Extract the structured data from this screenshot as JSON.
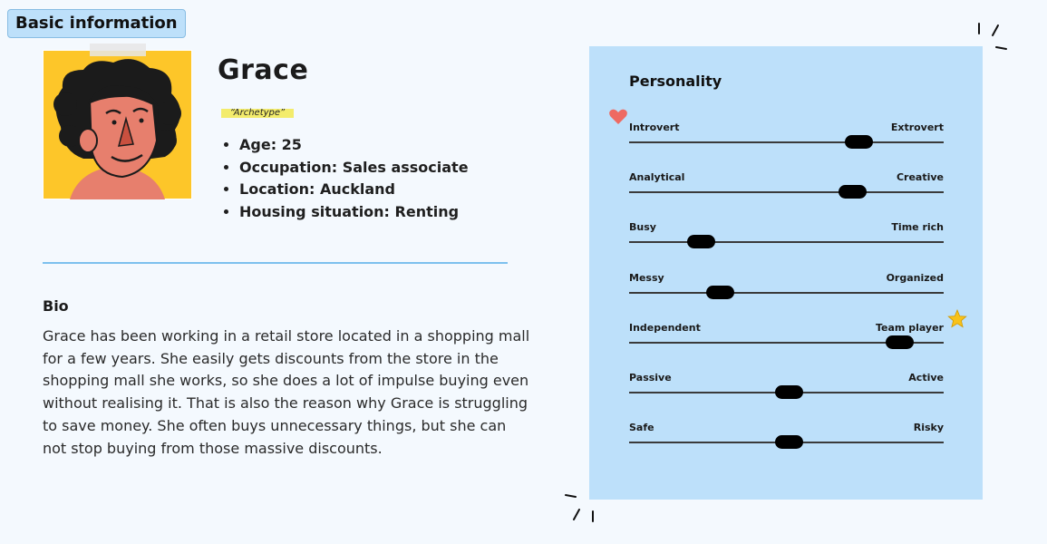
{
  "header": {
    "tag_label": "Basic information"
  },
  "profile": {
    "name": "Grace",
    "archetype": "“Archetype”",
    "facts": [
      "Age: 25",
      "Occupation: Sales associate",
      "Location: Auckland",
      "Housing situation: Renting"
    ]
  },
  "bio": {
    "title": "Bio",
    "text": "Grace has been working in a retail store located in a shopping mall for a few years. She easily gets discounts from the store in the shopping mall she works, so she does a lot of impulse buying even without realising it. That is also the reason why Grace is struggling to save money. She often buys unnecessary things, but she can not stop buying from those massive discounts."
  },
  "personality": {
    "title": "Personality",
    "traits": [
      {
        "left": "Introvert",
        "right": "Extrovert",
        "value": 0.73
      },
      {
        "left": "Analytical",
        "right": "Creative",
        "value": 0.71
      },
      {
        "left": "Busy",
        "right": "Time rich",
        "value": 0.23
      },
      {
        "left": "Messy",
        "right": "Organized",
        "value": 0.29
      },
      {
        "left": "Independent",
        "right": "Team player",
        "value": 0.86
      },
      {
        "left": "Passive",
        "right": "Active",
        "value": 0.51
      },
      {
        "left": "Safe",
        "right": "Risky",
        "value": 0.51
      }
    ]
  },
  "icons": {
    "heart": "heart-icon",
    "star": "star-icon"
  },
  "colors": {
    "tag_background": "#bde0fa",
    "panel_background": "#bde0fa",
    "divider": "#7cc0ee",
    "archetype_highlight": "#f3ec6c",
    "avatar_background": "#fdc629",
    "heart": "#ee6a62",
    "star": "#f8c21a"
  }
}
